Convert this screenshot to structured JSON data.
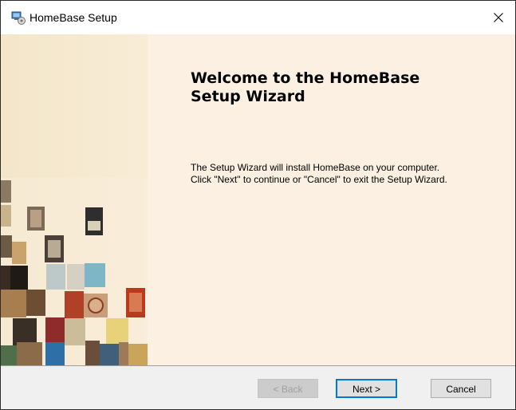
{
  "window": {
    "title": "HomeBase Setup",
    "icons": {
      "app": "installer-icon",
      "close": "close-icon"
    }
  },
  "wizard": {
    "title": "Welcome to the HomeBase\nSetup Wizard",
    "body": "The Setup Wizard will install HomeBase on your computer.\nClick \"Next\" to continue or \"Cancel\" to exit the Setup Wizard."
  },
  "buttons": {
    "back": "< Back",
    "next": "Next >",
    "cancel": "Cancel"
  },
  "colors": {
    "panel_bg": "#fbf0e1",
    "accent": "#0078d7",
    "footer_bg": "#f0f0f0"
  }
}
